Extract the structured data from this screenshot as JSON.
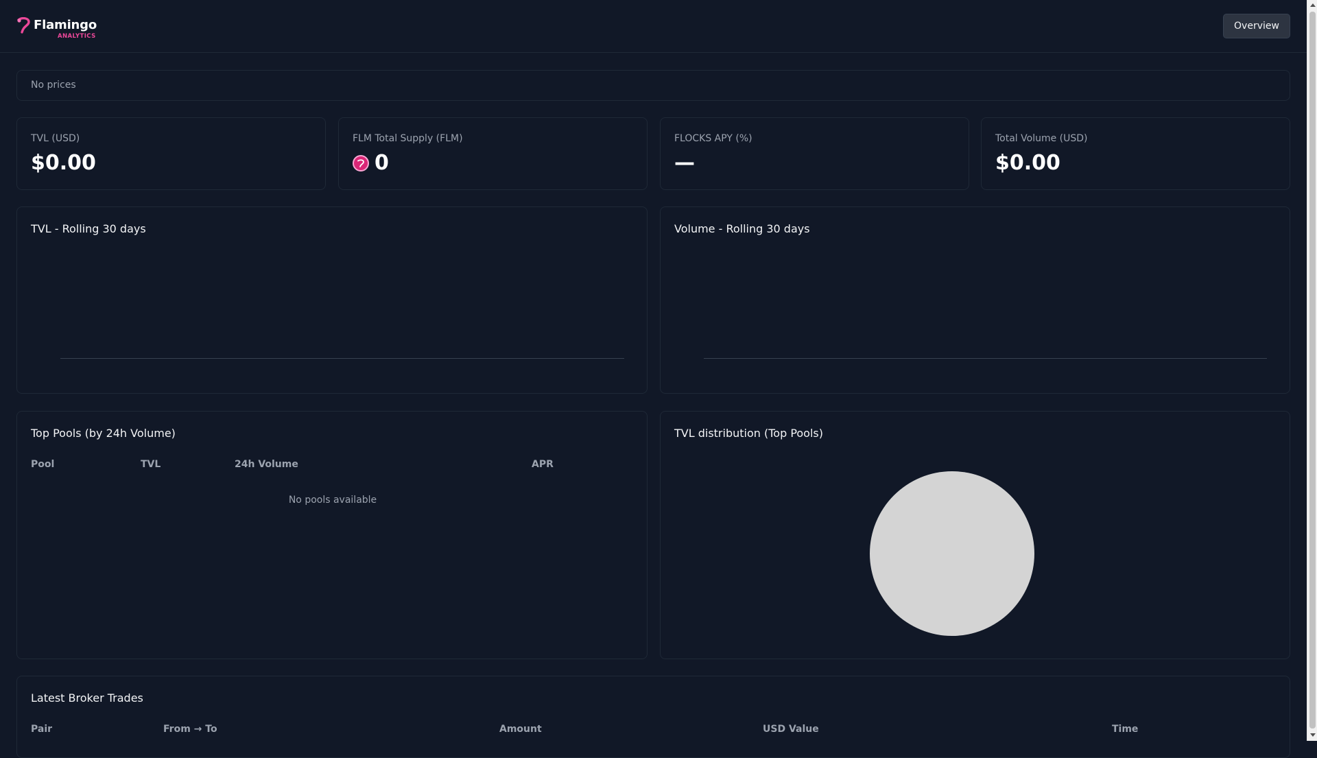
{
  "brand": {
    "name": "Flamingo",
    "subtitle": "ANALYTICS",
    "accent_color": "#ec4899"
  },
  "nav": {
    "overview_label": "Overview"
  },
  "prices": {
    "text": "No prices"
  },
  "stats": [
    {
      "label": "TVL (USD)",
      "value": "$0.00"
    },
    {
      "label": "FLM Total Supply (FLM)",
      "value": "0",
      "icon": "flm-token-icon"
    },
    {
      "label": "FLOCKS APY (%)",
      "value": "—"
    },
    {
      "label": "Total Volume (USD)",
      "value": "$0.00"
    }
  ],
  "charts": {
    "tvl_title": "TVL - Rolling 30 days",
    "volume_title": "Volume - Rolling 30 days",
    "distribution_title": "TVL distribution (Top Pools)",
    "pie_color": "#d4d4d4"
  },
  "top_pools": {
    "title": "Top Pools (by 24h Volume)",
    "columns": [
      "Pool",
      "TVL",
      "24h Volume",
      "APR"
    ],
    "empty_text": "No pools available"
  },
  "trades": {
    "title": "Latest Broker Trades",
    "columns": [
      "Pair",
      "From → To",
      "Amount",
      "USD Value",
      "Time"
    ]
  }
}
